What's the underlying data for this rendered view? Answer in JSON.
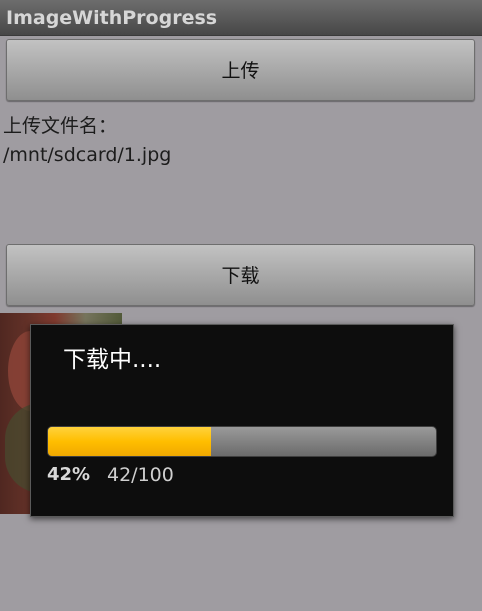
{
  "app": {
    "title": "ImageWithProgress"
  },
  "buttons": {
    "upload_label": "上传",
    "download_label": "下载"
  },
  "upload_info": {
    "label": "上传文件名：",
    "filename": "/mnt/sdcard/1.jpg"
  },
  "progress_dialog": {
    "title": "下载中....",
    "progress": 0.42,
    "percent_text": "42%",
    "count_text": "42/100",
    "fill_color": "#ffbe00"
  }
}
